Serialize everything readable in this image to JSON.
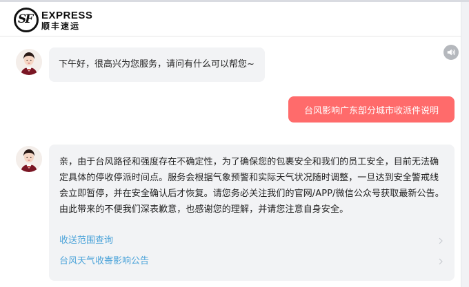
{
  "brand": {
    "mark": "SF",
    "name_en": "EXPRESS",
    "name_cn": "顺丰速运"
  },
  "chat": {
    "greeting": "下午好，很高兴为您服务，请问有什么可以帮您~",
    "user_message": "台风影响广东部分城市收派件说明",
    "reply": "亲，由于台风路径和强度存在不确定性，为了确保您的包裹安全和我们的员工安全，目前无法确定具体的停收停派时间点。服务会根据气象预警和实际天气状况随时调整，一旦达到安全警戒线会立即暂停，并在安全确认后才恢复。请您务必关注我们的官网/APP/微信公众号获取最新公告。由此带来的不便我们深表歉意，也感谢您的理解，并请您注意自身安全。",
    "links": [
      {
        "label": "收送范围查询"
      },
      {
        "label": "台风天气收寄影响公告"
      }
    ]
  },
  "colors": {
    "user_bubble": "#ff6b6b",
    "bot_bubble": "#f2f3f5",
    "link": "#4ba3d9"
  },
  "icons": {
    "sound": "speaker-icon",
    "chevron": "chevron-right-icon"
  }
}
